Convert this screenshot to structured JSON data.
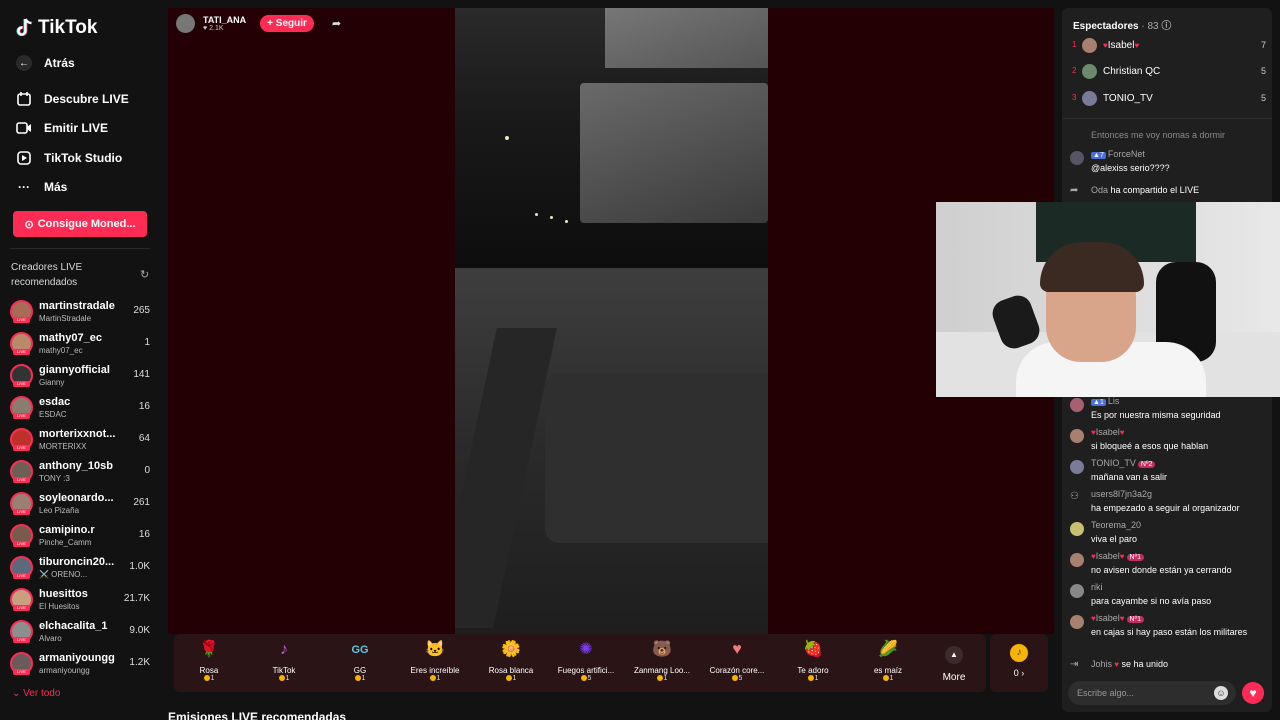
{
  "app": {
    "brand": "TikTok"
  },
  "sidebar": {
    "back": "Atrás",
    "nav": [
      {
        "label": "Descubre LIVE",
        "icon": "calendar-icon"
      },
      {
        "label": "Emitir LIVE",
        "icon": "camera-icon"
      },
      {
        "label": "TikTok Studio",
        "icon": "play-icon"
      },
      {
        "label": "Más",
        "icon": "more-icon"
      }
    ],
    "coins_button": "Consigue Moned...",
    "recommended_title": "Creadores LIVE recomendados",
    "creators": [
      {
        "name": "martinstradale",
        "sub": "MartinStradale",
        "count": "265"
      },
      {
        "name": "mathy07_ec",
        "sub": "mathy07_ec",
        "count": "1"
      },
      {
        "name": "giannyofficial",
        "sub": "Gianny",
        "count": "141"
      },
      {
        "name": "esdac",
        "sub": "ESDAC",
        "count": "16"
      },
      {
        "name": "morterixxnot...",
        "sub": "MORTERIXX",
        "count": "64"
      },
      {
        "name": "anthony_10sb",
        "sub": "TONY :3",
        "count": "0"
      },
      {
        "name": "soyleonardo...",
        "sub": "Leo Pizaña",
        "count": "261"
      },
      {
        "name": "camipino.r",
        "sub": "Pinche_Camm",
        "count": "16"
      },
      {
        "name": "tiburoncin20...",
        "sub": "⚔️ ORENO...",
        "count": "1.0K"
      },
      {
        "name": "huesittos",
        "sub": "El Huesitos",
        "count": "21.7K"
      },
      {
        "name": "elchacalita_1",
        "sub": "Alvaro",
        "count": "9.0K"
      },
      {
        "name": "armaniyoungg",
        "sub": "armaniyoungg",
        "count": "1.2K"
      }
    ],
    "see_all": "Ver todo"
  },
  "stream": {
    "host_name": "TATI_ANA",
    "host_likes": "2.1K",
    "follow": "+ Seguir"
  },
  "gifts": [
    {
      "name": "Rosa",
      "price": "1",
      "icon": "🌹",
      "color": "#e0334a"
    },
    {
      "name": "TikTok",
      "price": "1",
      "icon": "♪",
      "color": "#c25bd6"
    },
    {
      "name": "GG",
      "price": "1",
      "icon": "GG",
      "color": "#5bc7e6"
    },
    {
      "name": "Eres increíble",
      "price": "1",
      "icon": "🐱",
      "color": "#c8a27a"
    },
    {
      "name": "Rosa blanca",
      "price": "1",
      "icon": "🌼",
      "color": "#e8e8e8"
    },
    {
      "name": "Fuegos artifici...",
      "price": "5",
      "icon": "✺",
      "color": "#7a3cf0"
    },
    {
      "name": "Zanmang Loo...",
      "price": "1",
      "icon": "🐻",
      "color": "#f58fb5"
    },
    {
      "name": "Corazón core...",
      "price": "5",
      "icon": "♥",
      "color": "#f27a7a"
    },
    {
      "name": "Te adoro",
      "price": "1",
      "icon": "🍓",
      "color": "#e04848"
    },
    {
      "name": "es maíz",
      "price": "1",
      "icon": "🌽",
      "color": "#f5c542"
    }
  ],
  "more_label": "More",
  "coin_balance": "0 ›",
  "recommended_streams": "Emisiones LIVE recomendadas",
  "chat": {
    "viewers_title": "Espectadores",
    "viewers_count": "· 83",
    "top_viewers": [
      {
        "rank": "1",
        "name": "Isabel",
        "score": "7"
      },
      {
        "rank": "2",
        "name": "Christian QC",
        "score": "5"
      },
      {
        "rank": "3",
        "name": "TONIO_TV",
        "score": "5"
      }
    ],
    "messages_top": [
      {
        "text": "Entonces me voy nomas a dormir"
      },
      {
        "user": "ForceNet",
        "badge": "7",
        "text": "@alexiss serio????"
      },
      {
        "user": "Oda",
        "text": "ha compartido el LIVE"
      }
    ],
    "messages_bottom": [
      {
        "user": "Lis",
        "badge": "1",
        "text": "Es por nuestra misma seguridad"
      },
      {
        "user": "Isabel",
        "text": "si bloqueé a esos que hablan"
      },
      {
        "user": "TONIO_TV",
        "pill": "Nº2",
        "text": "mañana van a salir"
      },
      {
        "user": "users8l7jn3a2g",
        "text": "ha empezado a seguir al organizador"
      },
      {
        "user": "Teorema_20",
        "text": "viva el paro"
      },
      {
        "user": "Isabel",
        "pill": "Nº1",
        "text": "no avisen donde están ya cerrando"
      },
      {
        "user": "riki",
        "text": "para cayambe si no avía paso"
      },
      {
        "user": "Isabel",
        "pill": "Nº1",
        "text": "en cajas si hay paso están los militares"
      },
      {
        "user": "Johis",
        "text": "se ha unido"
      }
    ],
    "input_placeholder": "Escribe algo..."
  }
}
